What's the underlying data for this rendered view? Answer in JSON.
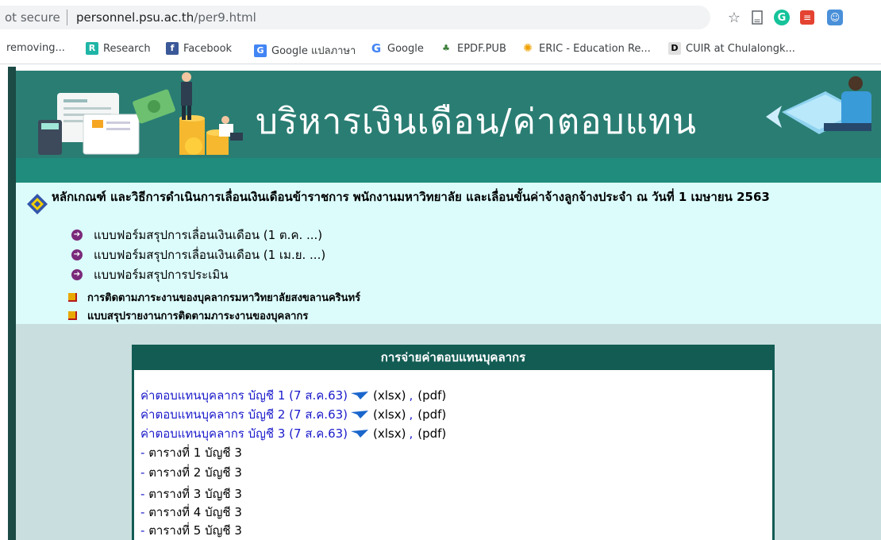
{
  "browser": {
    "security_label": "ot secure",
    "url_host": "personnel.psu.ac.th",
    "url_path": "/per9.html",
    "bookmarks": [
      {
        "label": "removing...",
        "icon": "none"
      },
      {
        "label": "Research",
        "icon": "researchgate-icon"
      },
      {
        "label": "Facebook",
        "icon": "facebook-icon"
      },
      {
        "label": "Google แปลภาษา",
        "icon": "google-translate-icon"
      },
      {
        "label": "Google",
        "icon": "google-icon"
      },
      {
        "label": "EPDF.PUB",
        "icon": "epdf-icon"
      },
      {
        "label": "ERIC - Education Re...",
        "icon": "eric-icon"
      },
      {
        "label": "CUIR at Chulalongk...",
        "icon": "cuir-icon"
      }
    ]
  },
  "banner": {
    "title": "บริหารเงินเดือน/ค่าตอบแทน"
  },
  "criteria": {
    "title": "หลักเกณฑ์ และวิธีการดำเนินการเลื่อนเงินเดือนข้าราชการ พนักงานมหาวิทยาลัย และเลื่อนขั้นค่าจ้างลูกจ้างประจำ ณ วันที่ 1 เมษายน 2563",
    "forms": [
      "แบบฟอร์มสรุปการเลื่อนเงินเดือน (1 ต.ค. ...)",
      "แบบฟอร์มสรุปการเลื่อนเงินเดือน (1 เม.ย. ...)",
      "แบบฟอร์มสรุปการประเมิน"
    ],
    "links": [
      "การติดตามภาระงานของบุคลากรมหาวิทยาลัยสงขลานครินทร์",
      "แบบสรุปรายงานการติดตามภาระงานของบุคลากร"
    ]
  },
  "payment": {
    "header": "การจ่ายค่าตอบแทนบุคลากร",
    "accounts": [
      {
        "label": "ค่าตอบแทนบุคลากร บัญชี 1 (7 ส.ค.63)",
        "xlsx": "(xlsx)",
        "sep": ",",
        "pdf": "(pdf)"
      },
      {
        "label": "ค่าตอบแทนบุคลากร บัญชี 2 (7 ส.ค.63)",
        "xlsx": "(xlsx)",
        "sep": ",",
        "pdf": "(pdf)"
      },
      {
        "label": "ค่าตอบแทนบุคลากร บัญชี 3 (7 ส.ค.63)",
        "xlsx": "(xlsx)",
        "sep": ",",
        "pdf": "(pdf)"
      }
    ],
    "tables": [
      "ตารางที่ 1 บัญชี 3",
      "ตารางที่ 2 บัญชี 3",
      "ตารางที่ 3 บัญชี 3",
      "ตารางที่ 4 บัญชี 3",
      "ตารางที่ 5 บัญชี 3"
    ]
  }
}
